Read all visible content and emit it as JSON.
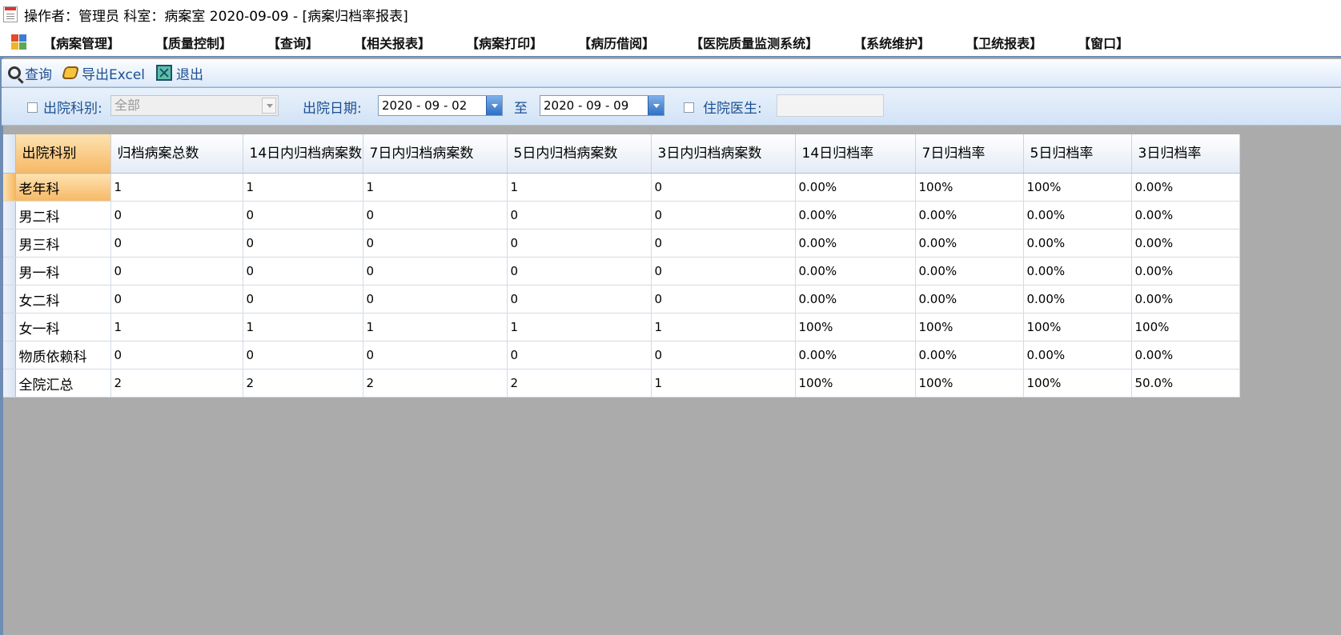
{
  "window": {
    "title": "操作者：管理员 科室：病案室  2020-09-09 - [病案归档率报表]"
  },
  "menu": {
    "items": [
      "【病案管理】",
      "【质量控制】",
      "【查询】",
      "【相关报表】",
      "【病案打印】",
      "【病历借阅】",
      "【医院质量监测系统】",
      "【系统维护】",
      "【卫统报表】",
      "【窗口】"
    ]
  },
  "toolbar": {
    "query_label": "查询",
    "export_label": "导出Excel",
    "exit_label": "退出"
  },
  "filters": {
    "dept_label": "出院科别:",
    "dept_value": "全部",
    "date_label": "出院日期:",
    "date_from": "2020 - 09 - 02",
    "to_label": "至",
    "date_to": "2020 - 09 - 09",
    "doctor_label": "住院医生:"
  },
  "table": {
    "headers": [
      "出院科别",
      "归档病案总数",
      "14日内归档病案数",
      "7日内归档病案数",
      "5日内归档病案数",
      "3日内归档病案数",
      "14日归档率",
      "7日归档率",
      "5日归档率",
      "3日归档率"
    ],
    "rows": [
      [
        "老年科",
        "1",
        "1",
        "1",
        "1",
        "0",
        "0.00%",
        "100%",
        "100%",
        "0.00%"
      ],
      [
        "男二科",
        "0",
        "0",
        "0",
        "0",
        "0",
        "0.00%",
        "0.00%",
        "0.00%",
        "0.00%"
      ],
      [
        "男三科",
        "0",
        "0",
        "0",
        "0",
        "0",
        "0.00%",
        "0.00%",
        "0.00%",
        "0.00%"
      ],
      [
        "男一科",
        "0",
        "0",
        "0",
        "0",
        "0",
        "0.00%",
        "0.00%",
        "0.00%",
        "0.00%"
      ],
      [
        "女二科",
        "0",
        "0",
        "0",
        "0",
        "0",
        "0.00%",
        "0.00%",
        "0.00%",
        "0.00%"
      ],
      [
        "女一科",
        "1",
        "1",
        "1",
        "1",
        "1",
        "100%",
        "100%",
        "100%",
        "100%"
      ],
      [
        "物质依赖科",
        "0",
        "0",
        "0",
        "0",
        "0",
        "0.00%",
        "0.00%",
        "0.00%",
        "0.00%"
      ],
      [
        "全院汇总",
        "2",
        "2",
        "2",
        "2",
        "1",
        "100%",
        "100%",
        "100%",
        "50.0%"
      ]
    ]
  }
}
